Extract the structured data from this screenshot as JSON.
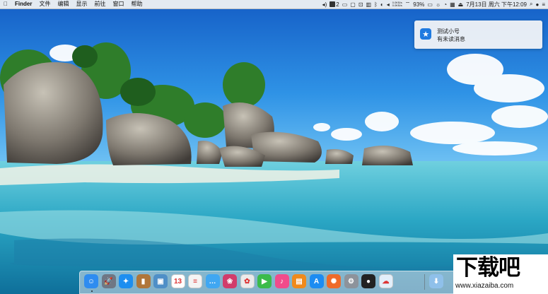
{
  "menubar": {
    "app_name": "Finder",
    "menus": [
      "文件",
      "编辑",
      "显示",
      "前往",
      "窗口",
      "帮助"
    ],
    "badge_count": "2",
    "net_up": "0.0KB/s",
    "net_down": "0.0KB/s",
    "battery": "93%",
    "datetime": "7月13日 周六 下午12:09"
  },
  "notification": {
    "title": "测试小号",
    "message": "有未读消息",
    "icon": "star-app-icon"
  },
  "dock": {
    "apps": [
      {
        "name": "finder-icon",
        "color": "#2e8cf0",
        "glyph": "☺"
      },
      {
        "name": "launchpad-icon",
        "color": "#6f7784",
        "glyph": "🚀"
      },
      {
        "name": "safari-icon",
        "color": "#1d8ef0",
        "glyph": "✦"
      },
      {
        "name": "notes-book-icon",
        "color": "#b0763a",
        "glyph": "▮"
      },
      {
        "name": "preview-icon",
        "color": "#4f8fc7",
        "glyph": "▣"
      },
      {
        "name": "calendar-icon",
        "color": "#ffffff",
        "glyph": "13"
      },
      {
        "name": "reminders-icon",
        "color": "#f4f4f4",
        "glyph": "≡"
      },
      {
        "name": "messages-icon",
        "color": "#40a7f2",
        "glyph": "…"
      },
      {
        "name": "photo-booth-icon",
        "color": "#d23c6b",
        "glyph": "❀"
      },
      {
        "name": "photos-icon",
        "color": "#ebebeb",
        "glyph": "✿"
      },
      {
        "name": "facetime-icon",
        "color": "#3bbb4a",
        "glyph": "▶"
      },
      {
        "name": "itunes-icon",
        "color": "#f14b8b",
        "glyph": "♪"
      },
      {
        "name": "ibooks-icon",
        "color": "#f08a1c",
        "glyph": "▤"
      },
      {
        "name": "app-store-icon",
        "color": "#1c8cf2",
        "glyph": "A"
      },
      {
        "name": "colorful-app-icon",
        "color": "#ee6b2a",
        "glyph": "✺"
      },
      {
        "name": "system-preferences-icon",
        "color": "#8d939b",
        "glyph": "⚙"
      },
      {
        "name": "qq-icon",
        "color": "#222222",
        "glyph": "●"
      },
      {
        "name": "cloud-app-icon",
        "color": "#e3effa",
        "glyph": "☁"
      }
    ],
    "trash": {
      "name": "downloads-folder-icon",
      "color": "#8fc0ea",
      "glyph": "⬇"
    }
  },
  "watermark": {
    "logo_text": "下载吧",
    "url": "www.xiazaiba.com"
  }
}
